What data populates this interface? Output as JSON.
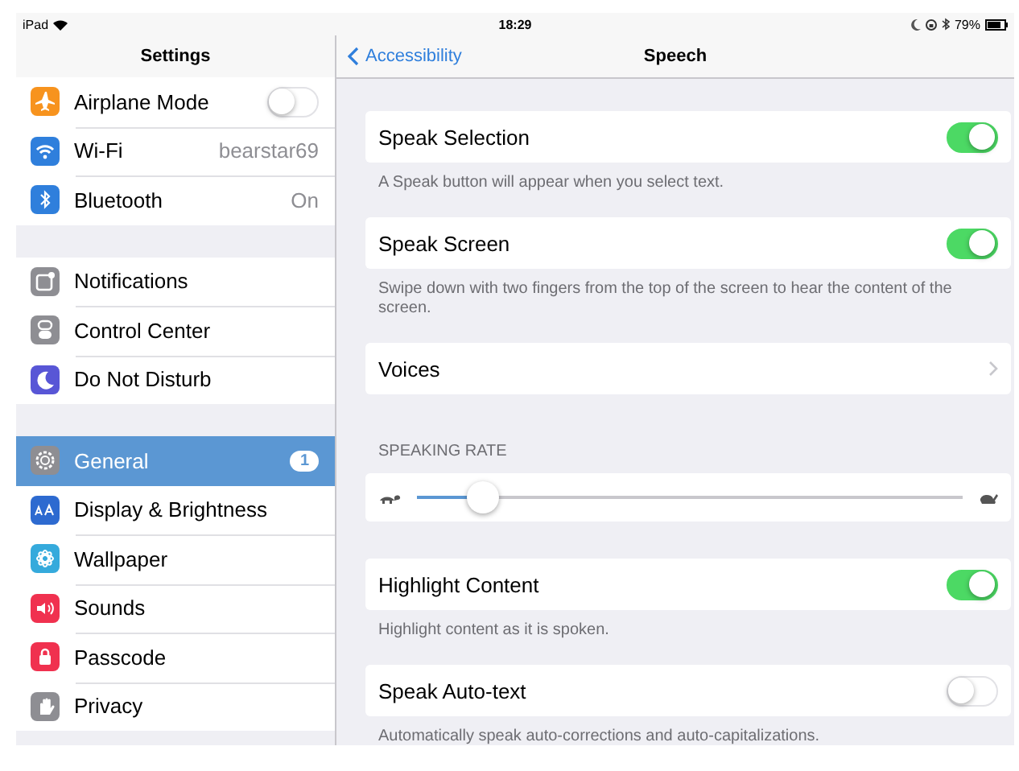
{
  "status_bar": {
    "device": "iPad",
    "time": "18:29",
    "battery": "79%"
  },
  "sidebar": {
    "title": "Settings",
    "groups": [
      [
        {
          "label": "Airplane Mode",
          "kind": "toggle",
          "on": false,
          "color": "#f7931e",
          "selected": false
        },
        {
          "label": "Wi-Fi",
          "kind": "value",
          "value": "bearstar69",
          "color": "#2f7fdc",
          "selected": false
        },
        {
          "label": "Bluetooth",
          "kind": "value",
          "value": "On",
          "color": "#2f7fdc",
          "selected": false
        }
      ],
      [
        {
          "label": "Notifications",
          "kind": "plain",
          "color": "#8e8e93",
          "selected": false
        },
        {
          "label": "Control Center",
          "kind": "plain",
          "color": "#8e8e93",
          "selected": false
        },
        {
          "label": "Do Not Disturb",
          "kind": "plain",
          "color": "#5856d6",
          "selected": false
        }
      ],
      [
        {
          "label": "General",
          "kind": "badge",
          "badge": "1",
          "color": "#8e8e93",
          "selected": true
        },
        {
          "label": "Display & Brightness",
          "kind": "plain",
          "color": "#2d6ad0",
          "selected": false
        },
        {
          "label": "Wallpaper",
          "kind": "plain",
          "color": "#35aadc",
          "selected": false
        },
        {
          "label": "Sounds",
          "kind": "plain",
          "color": "#f0314f",
          "selected": false
        },
        {
          "label": "Passcode",
          "kind": "plain",
          "color": "#f0314f",
          "selected": false
        },
        {
          "label": "Privacy",
          "kind": "plain",
          "color": "#8e8e93",
          "selected": false
        }
      ]
    ]
  },
  "detail": {
    "back": "Accessibility",
    "title": "Speech",
    "sections": [
      {
        "kind": "toggle",
        "label": "Speak Selection",
        "on": true,
        "footer": "A Speak button will appear when you select text."
      },
      {
        "kind": "toggle",
        "label": "Speak Screen",
        "on": true,
        "footer": "Swipe down with two fingers from the top of the screen to hear the content of the screen."
      },
      {
        "kind": "link",
        "label": "Voices"
      },
      {
        "kind": "slider",
        "header": "SPEAKING RATE",
        "level": 0.12
      },
      {
        "kind": "toggle",
        "label": "Highlight Content",
        "on": true,
        "footer": "Highlight content as it is spoken."
      },
      {
        "kind": "toggle",
        "label": "Speak Auto-text",
        "on": false,
        "footer": "Automatically speak auto-corrections and auto-capitalizations."
      }
    ]
  }
}
